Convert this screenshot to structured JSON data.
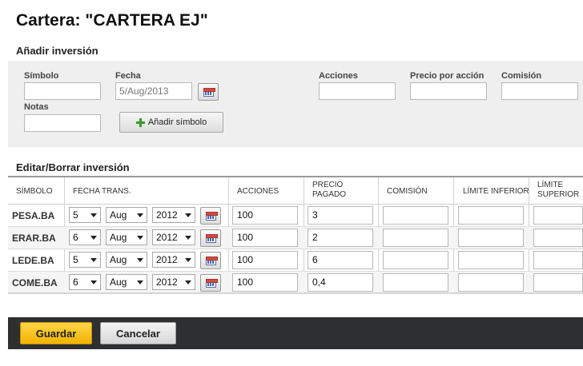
{
  "page": {
    "title": "Cartera: \"CARTERA EJ\""
  },
  "add_section": {
    "title": "Añadir inversión",
    "labels": {
      "symbol": "Símbolo",
      "date": "Fecha",
      "shares": "Acciones",
      "price_per_share": "Precio por acción",
      "commission": "Comisión",
      "notes": "Notas"
    },
    "values": {
      "symbol": "",
      "date": "5/Aug/2013",
      "shares": "",
      "price_per_share": "",
      "commission": "",
      "notes": ""
    },
    "add_button_label": "Añadir símbolo",
    "icons": {
      "add": "plus-icon",
      "calendar": "calendar-icon"
    }
  },
  "edit_section": {
    "title": "Editar/Borrar inversión",
    "columns": {
      "symbol": "SÍMBOLO",
      "trade_date": "FECHA TRANS.",
      "shares": "ACCIONES",
      "price_paid_1": "PRECIO",
      "price_paid_2": "PAGADO",
      "commission": "COMISIÓN",
      "lower_limit": "LÍMITE INFERIOR",
      "upper_limit_1": "LÍMITE",
      "upper_limit_2": "SUPERIOR"
    },
    "rows": [
      {
        "symbol": "PESA.BA",
        "day": "5",
        "month": "Aug",
        "year": "2012",
        "shares": "100",
        "price": "3",
        "commission": "",
        "lower_limit": "",
        "upper_limit": ""
      },
      {
        "symbol": "ERAR.BA",
        "day": "6",
        "month": "Aug",
        "year": "2012",
        "shares": "100",
        "price": "2",
        "commission": "",
        "lower_limit": "",
        "upper_limit": ""
      },
      {
        "symbol": "LEDE.BA",
        "day": "5",
        "month": "Aug",
        "year": "2012",
        "shares": "100",
        "price": "6",
        "commission": "",
        "lower_limit": "",
        "upper_limit": ""
      },
      {
        "symbol": "COME.BA",
        "day": "6",
        "month": "Aug",
        "year": "2012",
        "shares": "100",
        "price": "0,4",
        "commission": "",
        "lower_limit": "",
        "upper_limit": ""
      }
    ]
  },
  "footer": {
    "save_label": "Guardar",
    "cancel_label": "Cancelar"
  },
  "colors": {
    "save_button": "#f5c21b",
    "footer_bar": "#2e2f31",
    "panel_bg": "#efefef"
  }
}
